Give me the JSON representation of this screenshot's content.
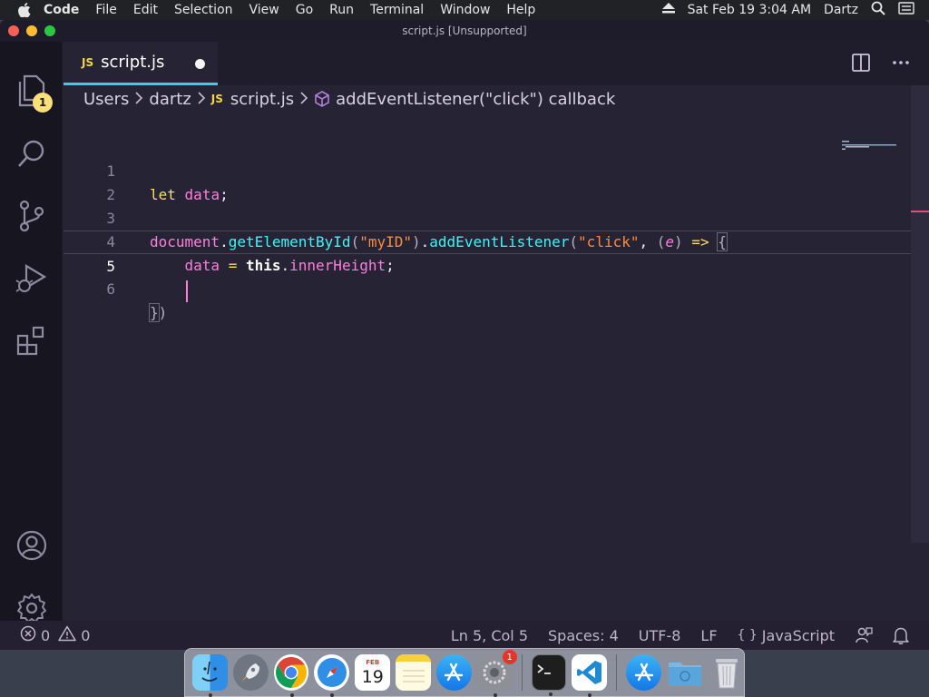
{
  "menubar": {
    "app": "Code",
    "items": [
      "File",
      "Edit",
      "Selection",
      "View",
      "Go",
      "Run",
      "Terminal",
      "Window",
      "Help"
    ],
    "datetime": "Sat Feb 19  3:04 AM",
    "user": "Dartz"
  },
  "window": {
    "title": "script.js [Unsupported]"
  },
  "activity": {
    "explorer_badge": "1"
  },
  "tab": {
    "icon": "JS",
    "name": "script.js"
  },
  "breadcrumb": {
    "parts": [
      "Users",
      "dartz"
    ],
    "file_icon": "JS",
    "file": "script.js",
    "symbol": "addEventListener(\"click\") callback"
  },
  "code": {
    "line_numbers": [
      "1",
      "2",
      "3",
      "4",
      "5",
      "6"
    ],
    "l1": {
      "kw": "let",
      "var": "data",
      "semi": ";"
    },
    "l3": {
      "obj": "document",
      "dot1": ".",
      "fn1": "getElementById",
      "p1": "(",
      "str1": "\"myID\"",
      "p2": ")",
      "dot2": ".",
      "fn2": "addEventListener",
      "p3": "(",
      "str2": "\"click\"",
      "comma": ", ",
      "p4": "(",
      "param": "e",
      "p5": ")",
      "arrow": " => ",
      "brace": "{"
    },
    "l4": {
      "indent": "    ",
      "var": "data",
      "eq": " = ",
      "this": "this",
      "dot": ".",
      "prop": "innerHeight",
      "semi": ";"
    },
    "l5": {
      "indent": "    "
    },
    "l6": {
      "brace": "}",
      "paren": ")"
    }
  },
  "statusbar": {
    "errors": "0",
    "warnings": "0",
    "position": "Ln 5, Col 5",
    "spaces": "Spaces: 4",
    "encoding": "UTF-8",
    "eol": "LF",
    "language_icon": "{ }",
    "language": "JavaScript"
  },
  "dock": {
    "calendar_month": "FEB",
    "calendar_day": "19",
    "prefs_badge": "1",
    "apps": [
      "finder-icon",
      "launchpad-icon",
      "chrome-icon",
      "safari-icon",
      "calendar-icon",
      "notes-icon",
      "app-store-icon",
      "system-preferences-icon",
      "terminal-icon",
      "vscode-icon",
      "app-store-icon",
      "downloads-folder-icon",
      "trash-icon"
    ]
  },
  "colors": {
    "editor_bg": "#262335",
    "accent": "#2fd3f0",
    "keyword": "#fede5d",
    "variable": "#ff7edb",
    "function": "#36f9f6",
    "string": "#ff8b39"
  }
}
